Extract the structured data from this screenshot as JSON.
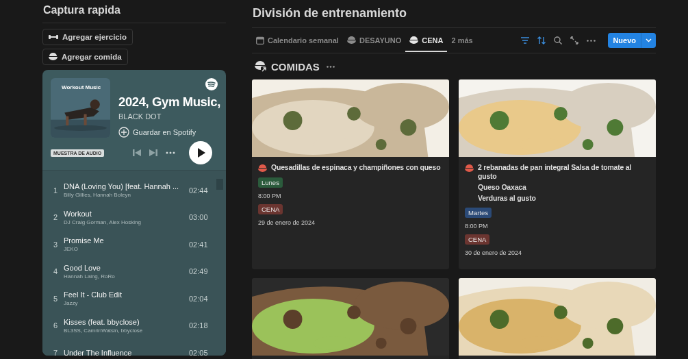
{
  "sidebar": {
    "title": "Captura rapida",
    "buttons": [
      {
        "kind": "dumbbell",
        "label": "Agregar ejercicio"
      },
      {
        "kind": "bowl",
        "label": "Agregar comida"
      }
    ],
    "player": {
      "cover_label": "Workout Music",
      "title": "2024, Gym Music,",
      "artist": "BLACK DOT",
      "save": "Guardar en Spotify",
      "badge": "MUESTRA DE AUDIO",
      "tracks": [
        {
          "num": "1",
          "title": "DNA (Loving You) [feat. Hannah ...",
          "artists": "Billy Gillies, Hannah Boleyn",
          "duration": "02:44"
        },
        {
          "num": "2",
          "title": "Workout",
          "artists": "DJ Craig Gorman, Alex Hosking",
          "duration": "03:00"
        },
        {
          "num": "3",
          "title": "Promise Me",
          "artists": "JEKO",
          "duration": "02:41"
        },
        {
          "num": "4",
          "title": "Good Love",
          "artists": "Hannah Laing, RoRo",
          "duration": "02:49"
        },
        {
          "num": "5",
          "title": "Feel It - Club Edit",
          "artists": "Jazzy",
          "duration": "02:04"
        },
        {
          "num": "6",
          "title": "Kisses (feat. bbyclose)",
          "artists": "BL3SS, CamrinWatsin, bbyclose",
          "duration": "02:18"
        },
        {
          "num": "7",
          "title": "Under The Influence",
          "duration": "02:05"
        }
      ]
    }
  },
  "main": {
    "title": "División de entrenamiento",
    "tabs": [
      {
        "kind": "calendar",
        "label": "Calendario semanal",
        "selected": false
      },
      {
        "kind": "bowl",
        "label": "DESAYUNO",
        "selected": false
      },
      {
        "kind": "bowl",
        "label": "CENA",
        "selected": true
      }
    ],
    "more_tabs": "2 más",
    "new_button": "Nuevo",
    "section_title": "COMIDAS",
    "cards": [
      {
        "kind": "meal",
        "title_lines": [
          "Quesadillas de espinaca y champiñones con queso"
        ],
        "tags": [
          {
            "label": "Lunes",
            "color": "#2b5b3c"
          }
        ],
        "time": "8:00 PM",
        "category": {
          "label": "CENA",
          "color": "#6b3530"
        },
        "date": "29 de enero de 2024"
      },
      {
        "kind": "meal",
        "title_lines": [
          "2 rebanadas de pan integral Salsa de tomate al gusto",
          "Queso Oaxaca",
          "Verduras al gusto"
        ],
        "tags": [
          {
            "label": "Martes",
            "color": "#2b4a77"
          }
        ],
        "time": "8:00 PM",
        "category": {
          "label": "CENA",
          "color": "#6b3530"
        },
        "date": "30 de enero de 2024"
      },
      {
        "kind": "picture"
      },
      {
        "kind": "picture"
      }
    ]
  }
}
